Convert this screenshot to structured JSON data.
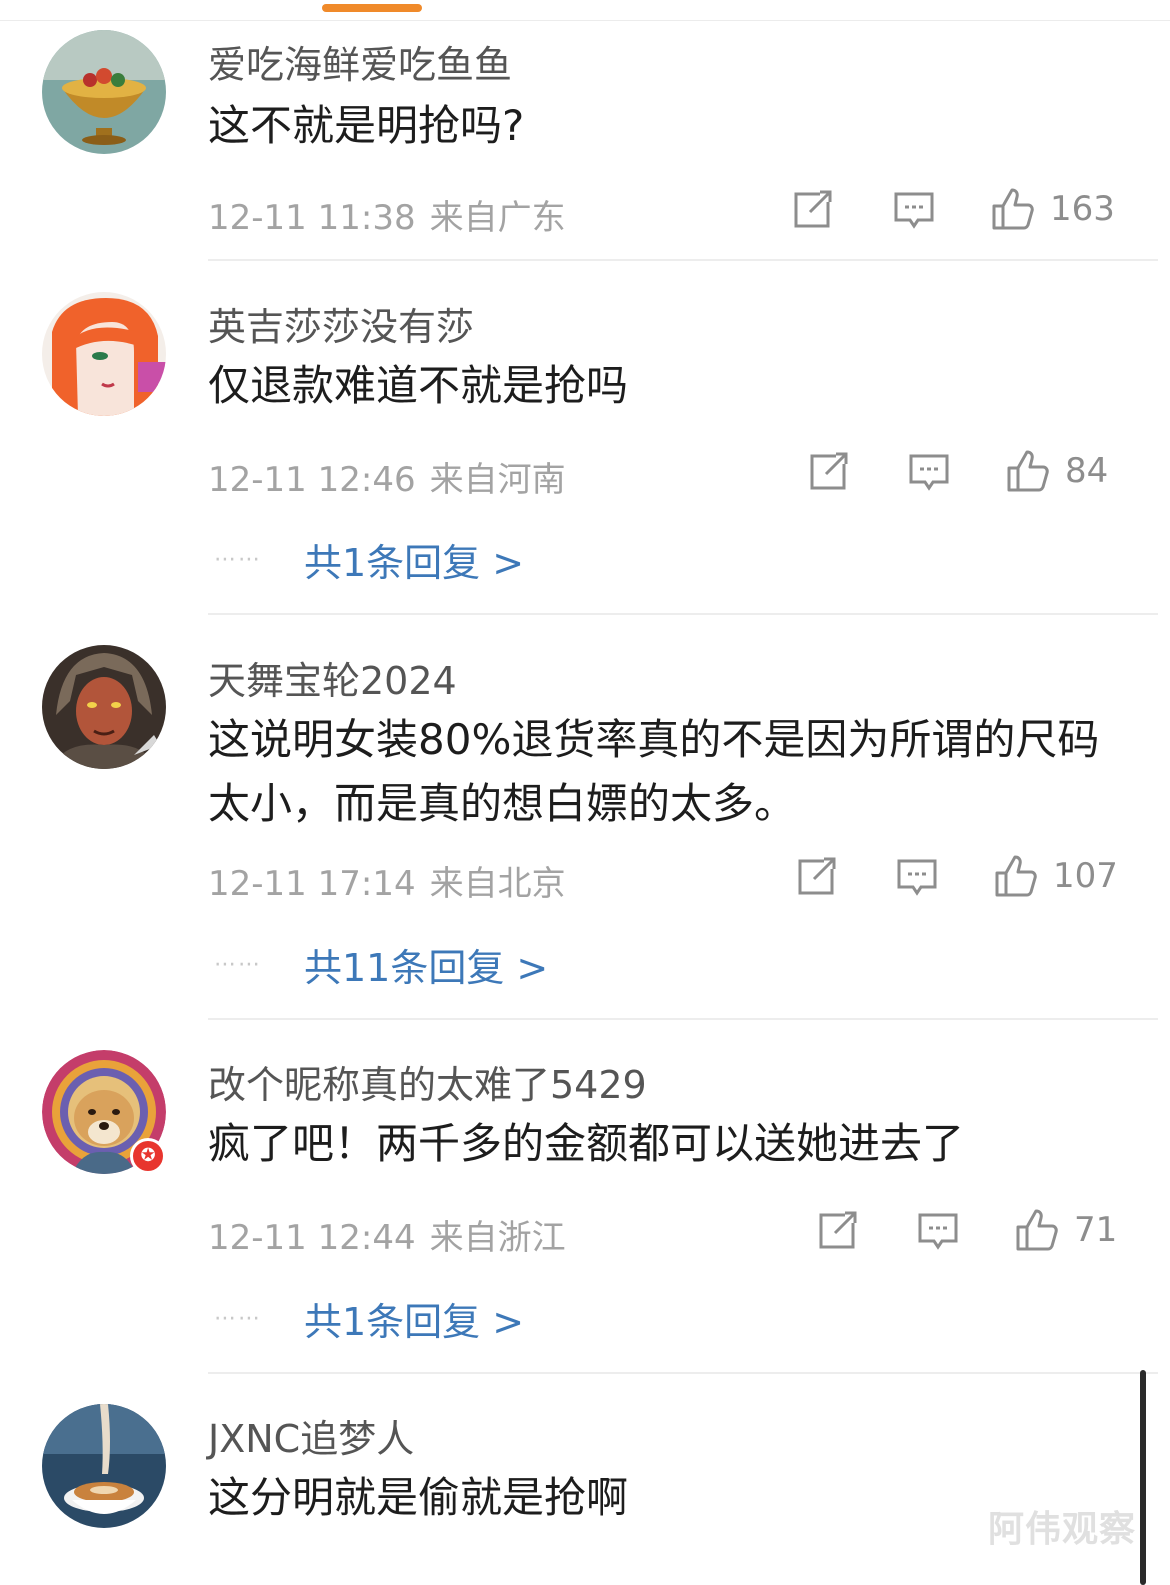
{
  "comments": [
    {
      "username": "爱吃海鲜爱吃鱼鱼",
      "text": "这不就是明抢吗?",
      "date": "12-11 11:38",
      "location": "来自广东",
      "likes": "163",
      "replies_label": ""
    },
    {
      "username": "英吉莎莎没有莎",
      "text": "仅退款难道不就是抢吗",
      "date": "12-11 12:46",
      "location": "来自河南",
      "likes": "84",
      "replies_label": "共1条回复 >"
    },
    {
      "username": "天舞宝轮2024",
      "text": "这说明女装80%退货率真的不是因为所谓的尺码太小，而是真的想白嫖的太多。",
      "date": "12-11 17:14",
      "location": "来自北京",
      "likes": "107",
      "replies_label": "共11条回复 >"
    },
    {
      "username": "改个昵称真的太难了5429",
      "text": "疯了吧！两千多的金额都可以送她进去了",
      "date": "12-11 12:44",
      "location": "来自浙江",
      "likes": "71",
      "replies_label": "共1条回复 >"
    },
    {
      "username": "JXNC追梦人",
      "text": "这分明就是偷就是抢啊"
    }
  ],
  "reply_dots": "⋯⋯",
  "watermark": "阿伟观察",
  "icons": {
    "share": "share-icon",
    "comment": "comment-icon",
    "like": "thumbs-up-icon"
  },
  "colors": {
    "accent": "#f08a2a",
    "link": "#3d78b8"
  }
}
